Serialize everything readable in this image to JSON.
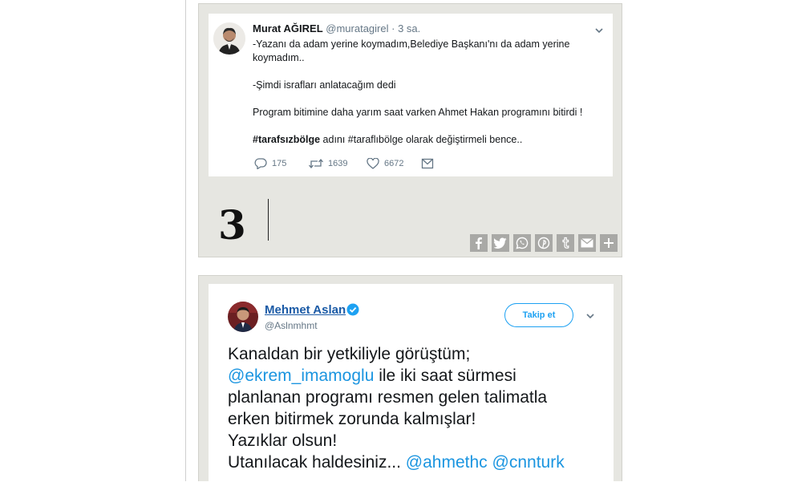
{
  "tweet1": {
    "name": "Murat AĞIREL",
    "handle": "@muratagirel",
    "separator": "·",
    "time": "3 sa.",
    "line1a": "-Yazanı da adam yerine koymadım,Belediye Başkanı'nı da adam yerine",
    "line1b": "koymadım..",
    "line2": "-Şimdi israfları anlatacağım dedi",
    "line3": "Program bitimine daha yarım saat varken Ahmet Hakan programını bitirdi !",
    "hashtag": "#tarafsızbölge",
    "line4_rest": " adını #taraflıbölge olarak değiştirmeli bence..",
    "replies": "175",
    "retweets": "1639",
    "likes": "6672",
    "icons": [
      "reply-icon",
      "retweet-icon",
      "like-icon",
      "dm-icon"
    ]
  },
  "band": {
    "number": "3",
    "share_icons": [
      "facebook-icon",
      "twitter-icon",
      "whatsapp-icon",
      "pinterest-icon",
      "tumblr-icon",
      "email-icon",
      "plus-icon"
    ]
  },
  "tweet2": {
    "name": "Mehmet Aslan",
    "handle": "@Aslnmhmt",
    "follow_label": "Takip et",
    "line1": "Kanaldan bir yetkiliyle görüştüm;",
    "mention1": "@ekrem_imamoglu",
    "line2_rest": " ile iki saat sürmesi",
    "line3": "planlanan programı resmen gelen talimatla",
    "line4": "erken bitirmek zorunda kalmışlar!",
    "line5": "Yazıklar olsun!",
    "line6_text": "Utanılacak haldesiniz... ",
    "mention2": "@ahmethc",
    "mention3": "@cnnturk"
  },
  "colors": {
    "link": "#1b95e0",
    "name_link": "#1a5aa6",
    "follow": "#1da1f2",
    "band": "#e6e6e1",
    "share_button": "#a9a9a6"
  }
}
